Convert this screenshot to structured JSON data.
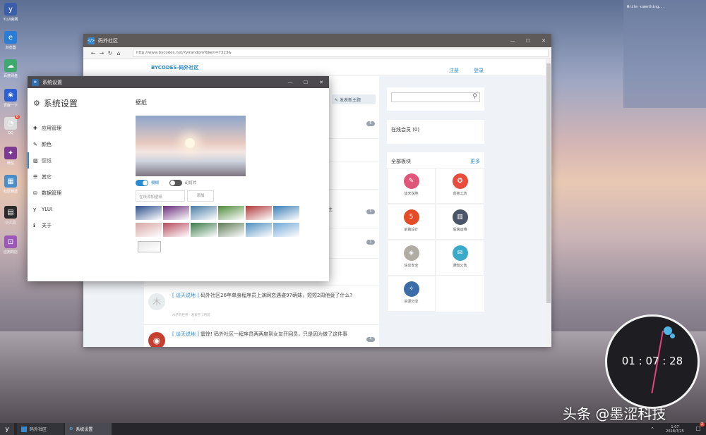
{
  "desktop": {
    "icons": [
      {
        "name": "YLUI官网",
        "color": "#3a5fa8",
        "glyph": "y"
      },
      {
        "name": "浏览器",
        "color": "#2a7dd6",
        "glyph": "e"
      },
      {
        "name": "百度网盘",
        "color": "#3da96f",
        "glyph": "☁"
      },
      {
        "name": "百度一下",
        "color": "#2d5fd1",
        "glyph": "❀"
      },
      {
        "name": "QQ",
        "color": "#dddddd",
        "glyph": "◔",
        "badge": "6"
      },
      {
        "name": "微信",
        "color": "#7c3a93",
        "glyph": "✦"
      },
      {
        "name": "社区精选",
        "color": "#4a8ec9",
        "glyph": "▦"
      },
      {
        "name": "小工具",
        "color": "#2b2b2b",
        "glyph": "▤"
      },
      {
        "name": "应用商店",
        "color": "#9b59b6",
        "glyph": "⊡"
      }
    ],
    "sticky_note": "Write something...",
    "clock": {
      "time": "01 : 07 : 28"
    },
    "watermark": "头条 @墨涩科技"
  },
  "browser": {
    "title": "码外社区",
    "url": "http://www.bycodes.net/?ylrandomToken=7323&",
    "brand": "BYCODES-码外社区",
    "register": "注册",
    "login": "登录",
    "post_button": "发表新主题",
    "counts": [
      "6",
      "1",
      "1",
      "4"
    ],
    "fragment": "主",
    "posts": [
      {
        "tag": "[ 谈天说地 ]",
        "title": "码外社区26年单身程序员上演网恋遇姿97萌妹，短短2周他竟了什么?",
        "meta": "木子的世界 · 发表于 1月前",
        "avatar": "木"
      },
      {
        "tag": "[ 谈天说地 ]",
        "title": "震惊! 码外社区一程序员两两度到女友开回员，只是因为做了这件事",
        "meta": "",
        "avatar": "◉"
      }
    ],
    "sidebar": {
      "online_members": "在线会员 (0)",
      "all_blocks": "全部板块",
      "more": "更多",
      "blocks": [
        {
          "label": "谈天说地",
          "color": "#e0567a",
          "glyph": "✎"
        },
        {
          "label": "创意工坊",
          "color": "#e74c3c",
          "glyph": "✪"
        },
        {
          "label": "前端设计",
          "color": "#e34c26",
          "glyph": "5"
        },
        {
          "label": "后端运维",
          "color": "#4a5568",
          "glyph": "▥"
        },
        {
          "label": "信息安全",
          "color": "#b0aca4",
          "glyph": "◈"
        },
        {
          "label": "通知公告",
          "color": "#3aaac9",
          "glyph": "✉"
        },
        {
          "label": "资源分享",
          "color": "#3b6ea8",
          "glyph": "✧"
        }
      ]
    }
  },
  "settings": {
    "window_title": "系统设置",
    "heading": "系统设置",
    "menu": [
      {
        "label": "应用管理",
        "icon": "puzzle-icon",
        "glyph": "✚"
      },
      {
        "label": "颜色",
        "icon": "brush-icon",
        "glyph": "✎"
      },
      {
        "label": "壁纸",
        "icon": "image-icon",
        "glyph": "▨"
      },
      {
        "label": "其它",
        "icon": "list-icon",
        "glyph": "☰"
      },
      {
        "label": "数据管理",
        "icon": "database-icon",
        "glyph": "⛁"
      },
      {
        "label": "YLUI",
        "icon": "ylui-icon",
        "glyph": "y"
      },
      {
        "label": "关于",
        "icon": "info-icon",
        "glyph": "ℹ"
      }
    ],
    "wallpaper_heading": "壁纸",
    "toggle_blur": "模糊",
    "toggle_slideshow": "幻灯片",
    "input_placeholder": "在线添加壁纸",
    "add_button": "添加",
    "thumbnails": [
      "#2c4f8e",
      "#6a2d7d",
      "#4a7ca6",
      "#4f8a3a",
      "#b03a3a",
      "#3a7fb8",
      "#d8a5a5",
      "#b84a5e",
      "#3a7a4a",
      "#5e7a56",
      "#4f8ec0",
      "#6fa8d6",
      "#e8e8e8"
    ]
  },
  "taskbar": {
    "items": [
      "码外社区",
      "系统设置"
    ],
    "time": "1:07",
    "date": "2018/7/25",
    "notif_badge": "2"
  }
}
